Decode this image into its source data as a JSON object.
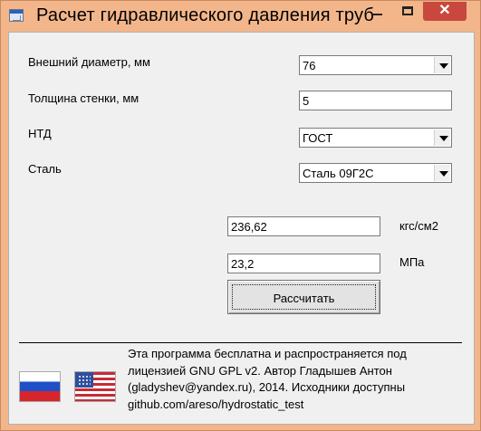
{
  "window": {
    "title": "Расчет гидравлического давления труб",
    "minimize_icon": "minimize-icon",
    "maximize_icon": "maximize-icon",
    "close_icon": "close-icon",
    "close_glyph": "✕"
  },
  "form": {
    "outer_diameter_label": "Внешний диаметр, мм",
    "outer_diameter_value": "76",
    "wall_thickness_label": "Толщина стенки, мм",
    "wall_thickness_value": "5",
    "ntd_label": "НТД",
    "ntd_value": "ГОСТ",
    "steel_label": "Сталь",
    "steel_value": "Сталь 09Г2С"
  },
  "results": {
    "pressure_kgf": "236,62",
    "pressure_kgf_unit": "кгс/см2",
    "pressure_mpa": "23,2",
    "pressure_mpa_unit": "МПа",
    "calculate_label": "Рассчитать"
  },
  "footer": {
    "lines": [
      "Эта программа бесплатна и распространяется под",
      "лицензией GNU GPL v2. Автор Гладышев Антон",
      "(gladyshev@yandex.ru), 2014. Исходники доступны",
      "github.com/areso/hydrostatic_test"
    ],
    "flags": [
      {
        "name": "russian-flag-icon"
      },
      {
        "name": "us-flag-icon"
      }
    ]
  }
}
